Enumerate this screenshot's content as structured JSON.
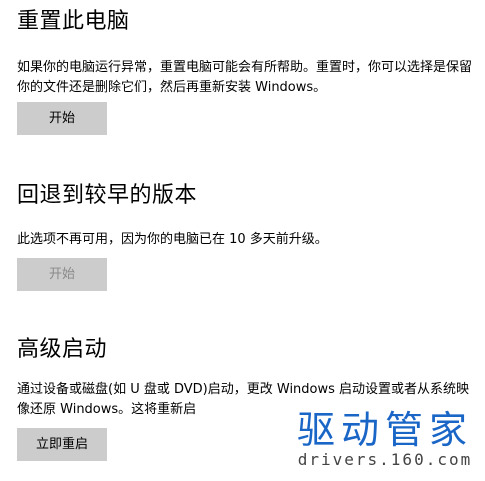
{
  "reset": {
    "title": "重置此电脑",
    "description": "如果你的电脑运行异常，重置电脑可能会有所帮助。重置时，你可以选择是保留你的文件还是删除它们，然后再重新安装 Windows。",
    "button_label": "开始"
  },
  "goback": {
    "title": "回退到较早的版本",
    "description": "此选项不再可用，因为你的电脑已在 10 多天前升级。",
    "button_label": "开始"
  },
  "advanced": {
    "title": "高级启动",
    "description": "通过设备或磁盘(如 U 盘或 DVD)启动，更改 Windows 启动设置或者从系统映像还原 Windows。这将重新启",
    "button_label": "立即重启"
  },
  "watermark": {
    "logo_text": "驱动管家",
    "url_text": "drivers.160.com"
  },
  "colors": {
    "button_bg": "#cccccc",
    "disabled_text": "#8a8a8a",
    "watermark_blue": "#1a66c7"
  }
}
